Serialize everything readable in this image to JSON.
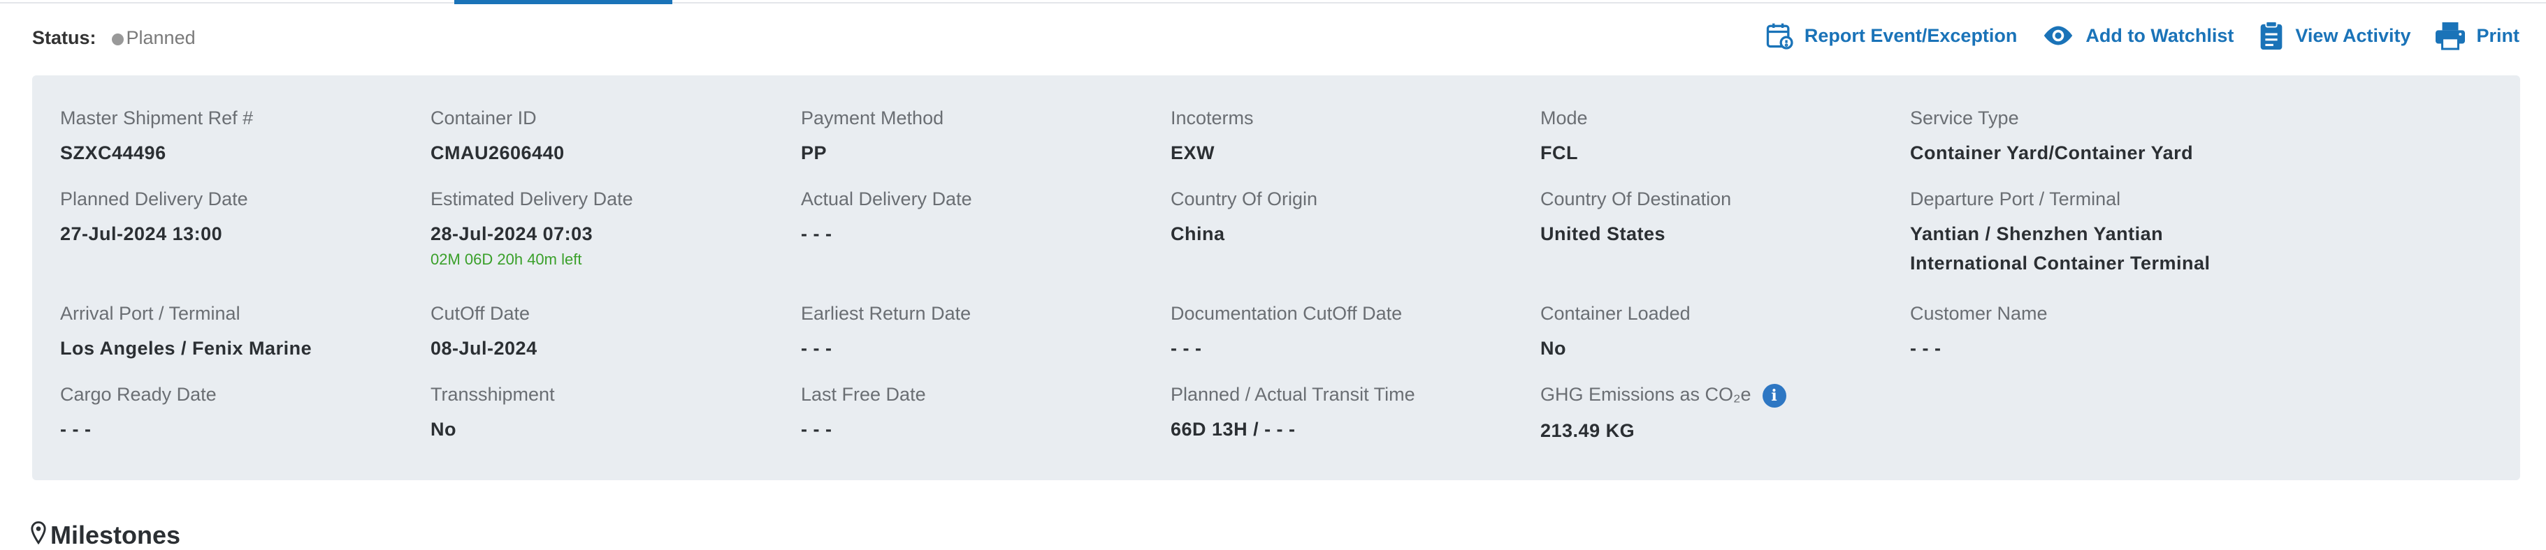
{
  "status": {
    "label": "Status:",
    "value": "Planned"
  },
  "actions": [
    {
      "label": "Report Event/Exception",
      "icon": "calendar-exception-icon"
    },
    {
      "label": "Add to Watchlist",
      "icon": "eye-icon"
    },
    {
      "label": "View Activity",
      "icon": "clipboard-icon"
    },
    {
      "label": "Print",
      "icon": "printer-icon"
    }
  ],
  "colors": {
    "accent": "#1a73b8",
    "panel_bg": "#e9edf1",
    "note_green": "#3aa02a"
  },
  "fields": [
    {
      "label": "Master Shipment Ref #",
      "value": "SZXC44496"
    },
    {
      "label": "Container ID",
      "value": "CMAU2606440"
    },
    {
      "label": "Payment Method",
      "value": "PP"
    },
    {
      "label": "Incoterms",
      "value": "EXW"
    },
    {
      "label": "Mode",
      "value": "FCL"
    },
    {
      "label": "Service Type",
      "value": "Container Yard/Container Yard"
    },
    {
      "label": "Planned Delivery Date",
      "value": "27-Jul-2024 13:00"
    },
    {
      "label": "Estimated Delivery Date",
      "value": "28-Jul-2024 07:03",
      "note": "02M 06D 20h 40m left"
    },
    {
      "label": "Actual Delivery Date",
      "value": "- - -"
    },
    {
      "label": "Country Of Origin",
      "value": "China"
    },
    {
      "label": "Country Of Destination",
      "value": "United States"
    },
    {
      "label": "Departure Port / Terminal",
      "value": "Yantian / Shenzhen Yantian International Container Terminal"
    },
    {
      "label": "Arrival Port / Terminal",
      "value": "Los Angeles / Fenix Marine"
    },
    {
      "label": "CutOff Date",
      "value": "08-Jul-2024"
    },
    {
      "label": "Earliest Return Date",
      "value": "- - -"
    },
    {
      "label": "Documentation CutOff Date",
      "value": "- - -"
    },
    {
      "label": "Container Loaded",
      "value": "No"
    },
    {
      "label": "Customer Name",
      "value": "- - -"
    },
    {
      "label": "Cargo Ready Date",
      "value": "- - -"
    },
    {
      "label": "Transshipment",
      "value": "No"
    },
    {
      "label": "Last Free Date",
      "value": "- - -"
    },
    {
      "label": "Planned / Actual Transit Time",
      "value": "66D 13H / - - -"
    },
    {
      "label": "GHG Emissions as CO₂e",
      "value": "213.49 KG",
      "info_icon": "i"
    }
  ],
  "milestones": {
    "title": "Milestones",
    "icon": "map-pin-icon"
  }
}
